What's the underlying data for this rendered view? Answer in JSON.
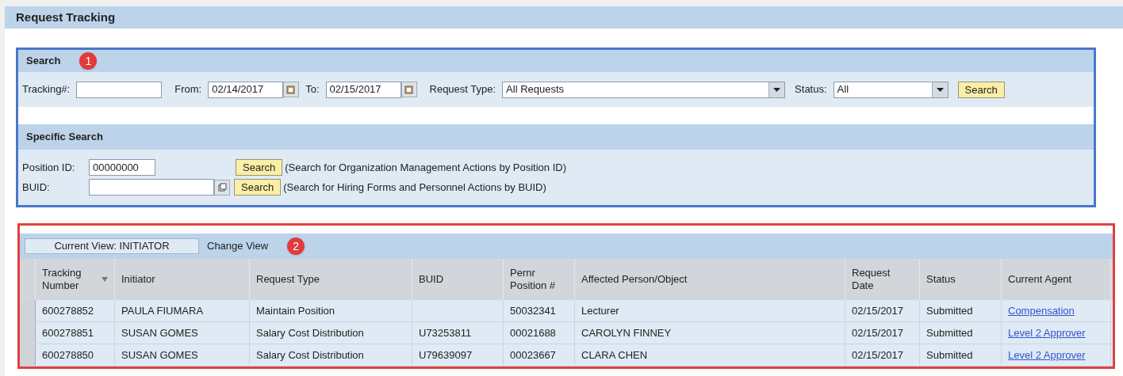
{
  "page_title": "Request Tracking",
  "search": {
    "title": "Search",
    "marker": "1",
    "tracking_label": "Tracking#:",
    "from_label": "From:",
    "from_value": "02/14/2017",
    "to_label": "To:",
    "to_value": "02/15/2017",
    "request_type_label": "Request Type:",
    "request_type_value": "All Requests",
    "status_label": "Status:",
    "status_value": "All",
    "button": "Search"
  },
  "specific_search": {
    "title": "Specific Search",
    "rows": [
      {
        "label": "Position ID:",
        "value": "00000000",
        "has_picker": false,
        "button": "Search",
        "note": "(Search for Organization Management Actions by Position ID)"
      },
      {
        "label": "BUID:",
        "has_picker": true,
        "button": "Search",
        "note": "(Search for Hiring Forms and Personnel Actions by BUID)"
      }
    ]
  },
  "results": {
    "current_view": "Current View: INITIATOR",
    "change_view": "Change View",
    "marker": "2",
    "columns": [
      {
        "label": "Tracking Number",
        "sortable": true
      },
      {
        "label": "Initiator",
        "sortable": false
      },
      {
        "label": "Request Type",
        "sortable": false
      },
      {
        "label": "BUID",
        "sortable": false
      },
      {
        "label": "Pernr Position #",
        "sortable": false
      },
      {
        "label": "Affected Person/Object",
        "sortable": false
      },
      {
        "label": "Request Date",
        "sortable": false
      },
      {
        "label": "Status",
        "sortable": false
      },
      {
        "label": "Current Agent",
        "sortable": false
      }
    ],
    "rows": [
      [
        "600278852",
        "PAULA FIUMARA",
        "Maintain Position",
        "",
        "50032341",
        "Lecturer",
        "02/15/2017",
        "Submitted",
        "Compensation"
      ],
      [
        "600278851",
        "SUSAN GOMES",
        "Salary Cost Distribution",
        "U73253811",
        "00021688",
        "CAROLYN FINNEY",
        "02/15/2017",
        "Submitted",
        "Level 2 Approver"
      ],
      [
        "600278850",
        "SUSAN GOMES",
        "Salary Cost Distribution",
        "U79639097",
        "00023667",
        "CLARA CHEN",
        "02/15/2017",
        "Submitted",
        "Level 2 Approver"
      ]
    ]
  }
}
